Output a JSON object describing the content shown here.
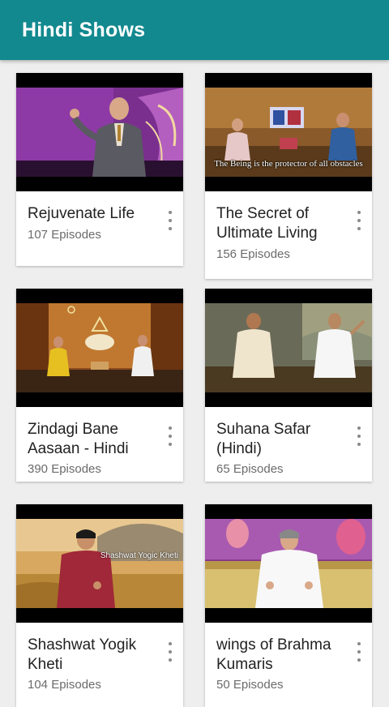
{
  "appbar": {
    "title": "Hindi Shows"
  },
  "shows": [
    {
      "title": "Rejuvenate Life",
      "episodes": "107 Episodes"
    },
    {
      "title": "The Secret of Ultimate Living",
      "episodes": "156 Episodes",
      "thumb_caption": "The Being is the protector of all obstacles"
    },
    {
      "title": "Zindagi Bane Aasaan - Hindi",
      "episodes": "390 Episodes"
    },
    {
      "title": "Suhana Safar (Hindi)",
      "episodes": "65 Episodes"
    },
    {
      "title": "Shashwat Yogik Kheti",
      "episodes": "104 Episodes",
      "thumb_caption": "Shashwat Yogic Kheti"
    },
    {
      "title": "wings of  Brahma Kumaris",
      "episodes": "50 Episodes"
    }
  ],
  "colors": {
    "appbar": "#12898f",
    "background": "#eeeeee",
    "card": "#ffffff"
  },
  "icons": {
    "card_menu": "more-vert-icon"
  }
}
